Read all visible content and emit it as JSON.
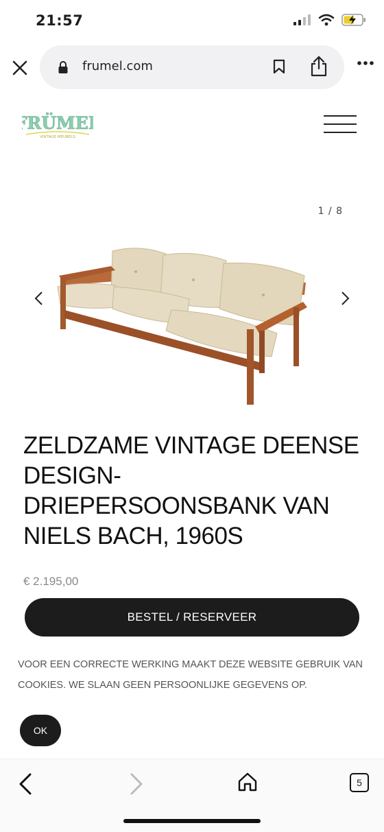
{
  "status_bar": {
    "time": "21:57"
  },
  "browser": {
    "url": "frumel.com",
    "tab_count": "5"
  },
  "site": {
    "logo_text": "FRÜMEL",
    "logo_tagline": "VINTAGE MEUBELS"
  },
  "gallery": {
    "counter": "1 / 8"
  },
  "product": {
    "title": "ZELDZAME VINTAGE DEENSE DESIGN-DRIEPERSOONSBANK VAN NIELS BACH, 1960S",
    "price": "€ 2.195,00",
    "order_label": "BESTEL / RESERVEER"
  },
  "cookie": {
    "text": "VOOR EEN CORRECTE WERKING MAAKT DEZE WEBSITE GEBRUIK VAN COOKIES. WE SLAAN GEEN PERSOONLIJKE GEGEVENS OP.",
    "ok_label": "OK"
  },
  "colors": {
    "logo_green": "#8ccfb0",
    "logo_yellow": "#e4d44a",
    "button_dark": "#1c1c1c"
  }
}
